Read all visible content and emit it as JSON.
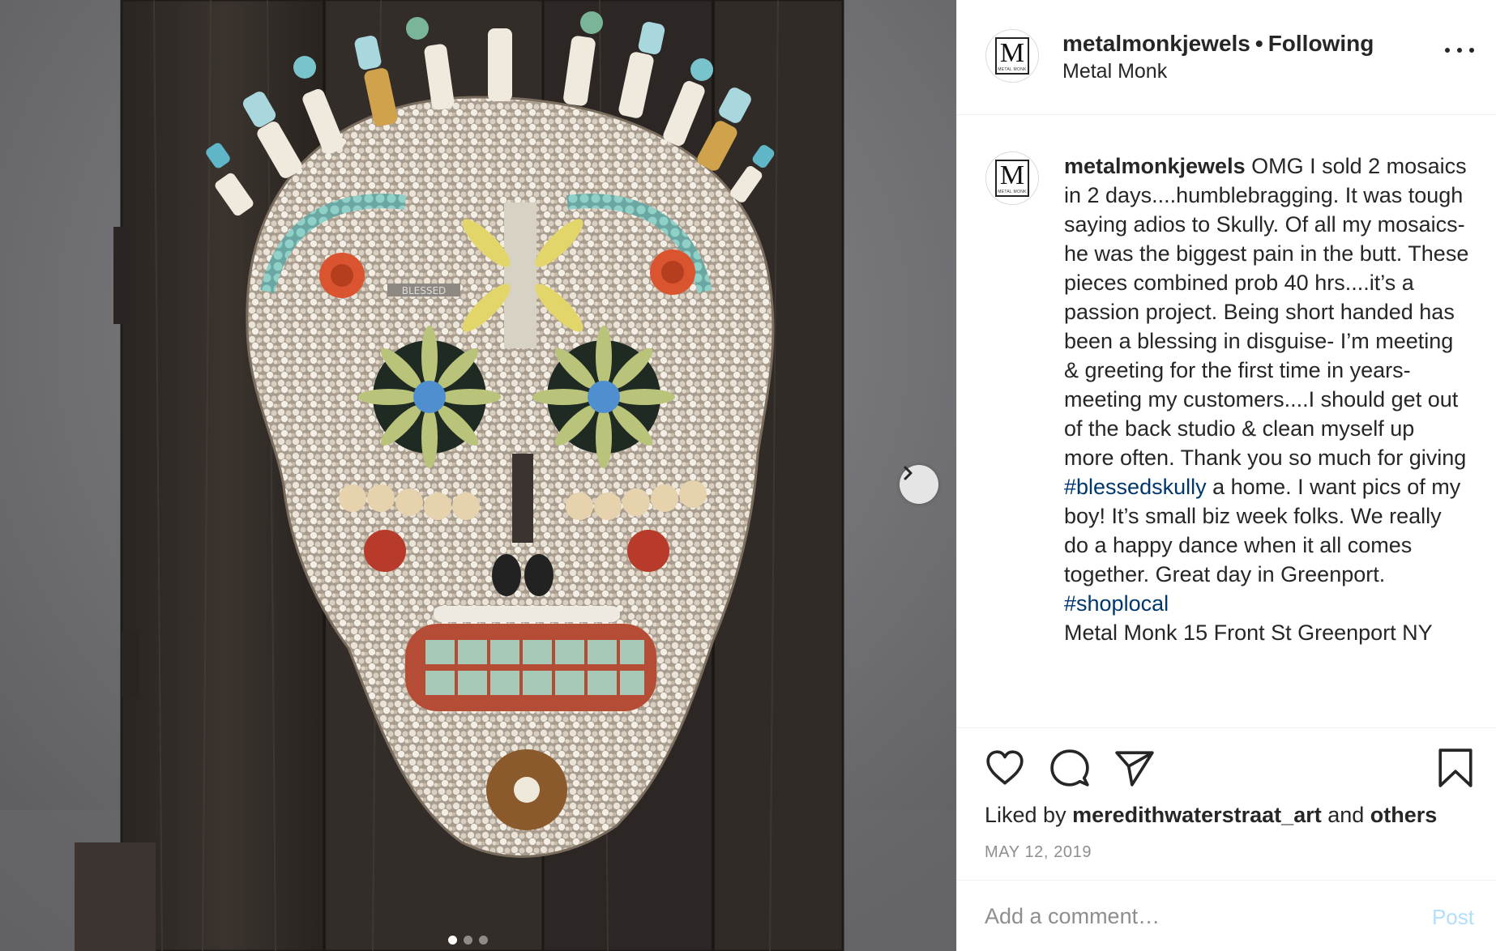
{
  "post": {
    "username": "metalmonkjewels",
    "separator": "•",
    "follow_status": "Following",
    "location": "Metal Monk",
    "avatar_letter": "M",
    "avatar_subtext": "METAL MONK"
  },
  "caption": {
    "username": "metalmonkjewels",
    "text_1": " OMG I sold 2 mosaics in 2 days....humblebragging. It was tough saying adios to Skully. Of all my mosaics- he was the biggest pain in the butt. These pieces combined prob 40 hrs....it’s a passion project. Being short handed has been a blessing in disguise- I’m meeting & greeting for the first time in years- meeting my customers....I should get out of the back studio & clean myself up more often. Thank you so much for giving ",
    "hashtag_1": "#blessedskully",
    "text_2": " a home. I want pics of my boy! It’s small biz week folks. We really do a happy dance when it all comes together. Great day in Greenport. ",
    "hashtag_2": "#shoplocal",
    "text_3": "Metal Monk 15 Front St Greenport NY"
  },
  "media": {
    "plaque_text": "BLESSED",
    "carousel_total": 3,
    "carousel_active": 0
  },
  "actions": {
    "liked_prefix": "Liked by ",
    "liked_user": "meredithwaterstraat_art",
    "liked_and": " and ",
    "liked_others": "others",
    "date": "MAY 12, 2019"
  },
  "comment": {
    "placeholder": "Add a comment…",
    "post_label": "Post"
  },
  "icons": [
    "more-options-icon",
    "chevron-right-icon",
    "heart-icon",
    "comment-icon",
    "share-icon",
    "bookmark-icon"
  ],
  "colors": {
    "hashtag": "#00376b",
    "post_disabled": "#b2dffc",
    "secondary_text": "#8e8e8e",
    "border": "#efefef"
  }
}
